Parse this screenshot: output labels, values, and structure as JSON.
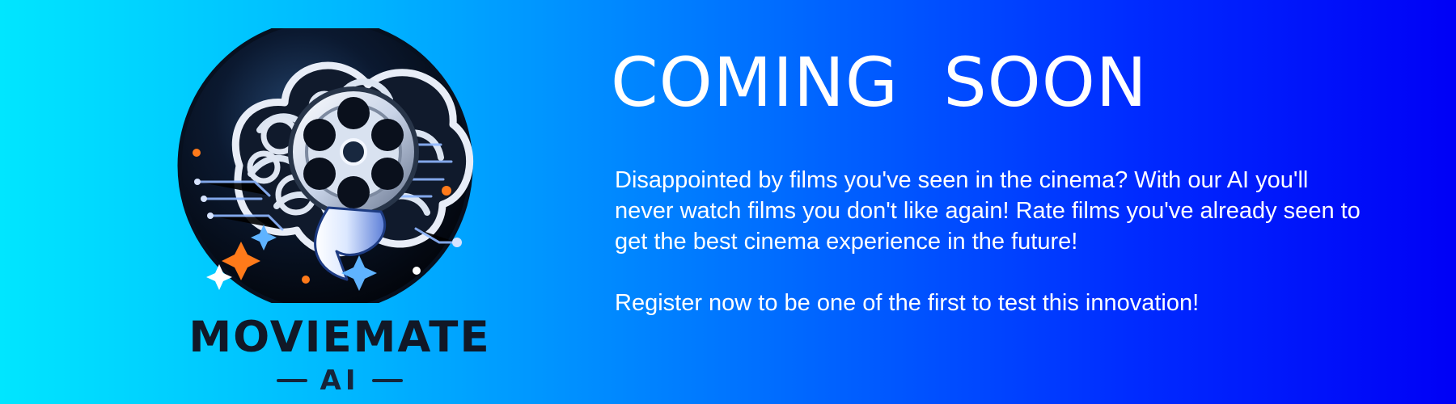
{
  "brand": {
    "name": "MOVIEMATE",
    "suffix": "AI",
    "logo_icon": "brain-film-reel-icon",
    "colors": {
      "background_start": "#00e6ff",
      "background_end": "#0000f6",
      "logo_disc": "#08111f",
      "logo_accent_orange": "#ff7a1a",
      "logo_accent_blue": "#4da8ff"
    }
  },
  "content": {
    "headline": "COMING  SOON",
    "paragraph_lines": [
      "Disappointed by films you've seen in the cinema? With our AI you'll",
      "never watch films you don't like again! Rate films you've already seen to",
      "get the best cinema experience in the future!"
    ],
    "cta": "Register now to be one of the first to test this innovation!"
  }
}
